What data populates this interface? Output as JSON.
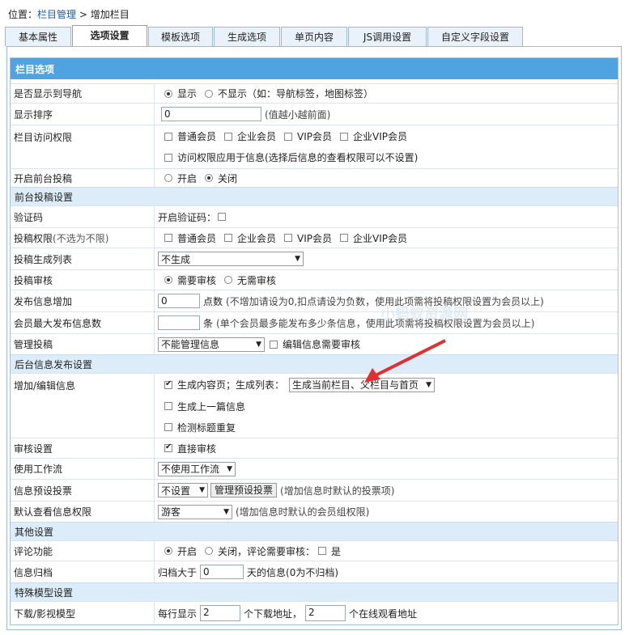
{
  "breadcrumb": {
    "prefix": "位置：",
    "link": "栏目管理",
    "sep": " > ",
    "current": "增加栏目"
  },
  "tabs": [
    "基本属性",
    "选项设置",
    "模板选项",
    "生成选项",
    "单页内容",
    "JS调用设置",
    "自定义字段设置"
  ],
  "active_tab": 1,
  "header": "栏目选项",
  "rows": {
    "nav": {
      "label": "是否显示到导航",
      "opt1": "显示",
      "opt2": "不显示（如：导航标签，地图标签）"
    },
    "order": {
      "label": "显示排序",
      "value": "0",
      "hint": "(值越小越前面)"
    },
    "access": {
      "label": "栏目访问权限",
      "o1": "普通会员",
      "o2": "企业会员",
      "o3": "VIP会员",
      "o4": "企业VIP会员",
      "apply": "访问权限应用于信息(选择后信息的查看权限可以不设置)"
    },
    "front_submit": {
      "label": "开启前台投稿",
      "opt1": "开启",
      "opt2": "关闭"
    },
    "sec1": "前台投稿设置",
    "captcha": {
      "label": "验证码",
      "text": "开启验证码："
    },
    "submit_perm": {
      "label": "投稿权限",
      "sub": "(不选为不限)",
      "o1": "普通会员",
      "o2": "企业会员",
      "o3": "VIP会员",
      "o4": "企业VIP会员"
    },
    "gen_list": {
      "label": "投稿生成列表",
      "select": "不生成"
    },
    "review": {
      "label": "投稿审核",
      "opt1": "需要审核",
      "opt2": "无需审核"
    },
    "points": {
      "label": "发布信息增加",
      "value": "0",
      "unit": "点数",
      "hint": "(不增加请设为0,扣点请设为负数，使用此项需将投稿权限设置为会员以上)"
    },
    "maxpost": {
      "label": "会员最大发布信息数",
      "value": "",
      "unit": "条",
      "hint": "(单个会员最多能发布多少条信息，使用此项需将投稿权限设置为会员以上)"
    },
    "manage": {
      "label": "管理投稿",
      "select": "不能管理信息",
      "edit": "编辑信息需要审核"
    },
    "sec2": "后台信息发布设置",
    "addedit": {
      "label": "增加/编辑信息",
      "gen": "生成内容页；生成列表：",
      "select": "生成当前栏目、父栏目与首页",
      "prev": "生成上一篇信息",
      "dup": "检测标题重复"
    },
    "audit": {
      "label": "审核设置",
      "text": "直接审核"
    },
    "workflow": {
      "label": "使用工作流",
      "select": "不使用工作流"
    },
    "vote": {
      "label": "信息预设投票",
      "select": "不设置",
      "btn": "管理预设投票",
      "hint": "(增加信息时默认的投票项)"
    },
    "view_perm": {
      "label": "默认查看信息权限",
      "select": "游客",
      "hint": "(增加信息时默认的会员组权限)"
    },
    "sec3": "其他设置",
    "comment": {
      "label": "评论功能",
      "opt1": "开启",
      "opt2": "关闭，评论需要审核：",
      "opt3": "是"
    },
    "archive": {
      "label": "信息归档",
      "pre": "归档大于",
      "value": "0",
      "post": "天的信息(0为不归档)"
    },
    "sec4": "特殊模型设置",
    "download": {
      "label": "下载/影视模型",
      "pre": "每行显示",
      "v1": "2",
      "mid": "个下载地址，",
      "v2": "2",
      "post": "个在线观看地址"
    }
  },
  "watermark": "小蚂蚁资源网",
  "colors": {
    "header": "#4ea3e0",
    "section": "#dcecf8",
    "link": "#1a5ca8",
    "arrow": "#e03030"
  }
}
